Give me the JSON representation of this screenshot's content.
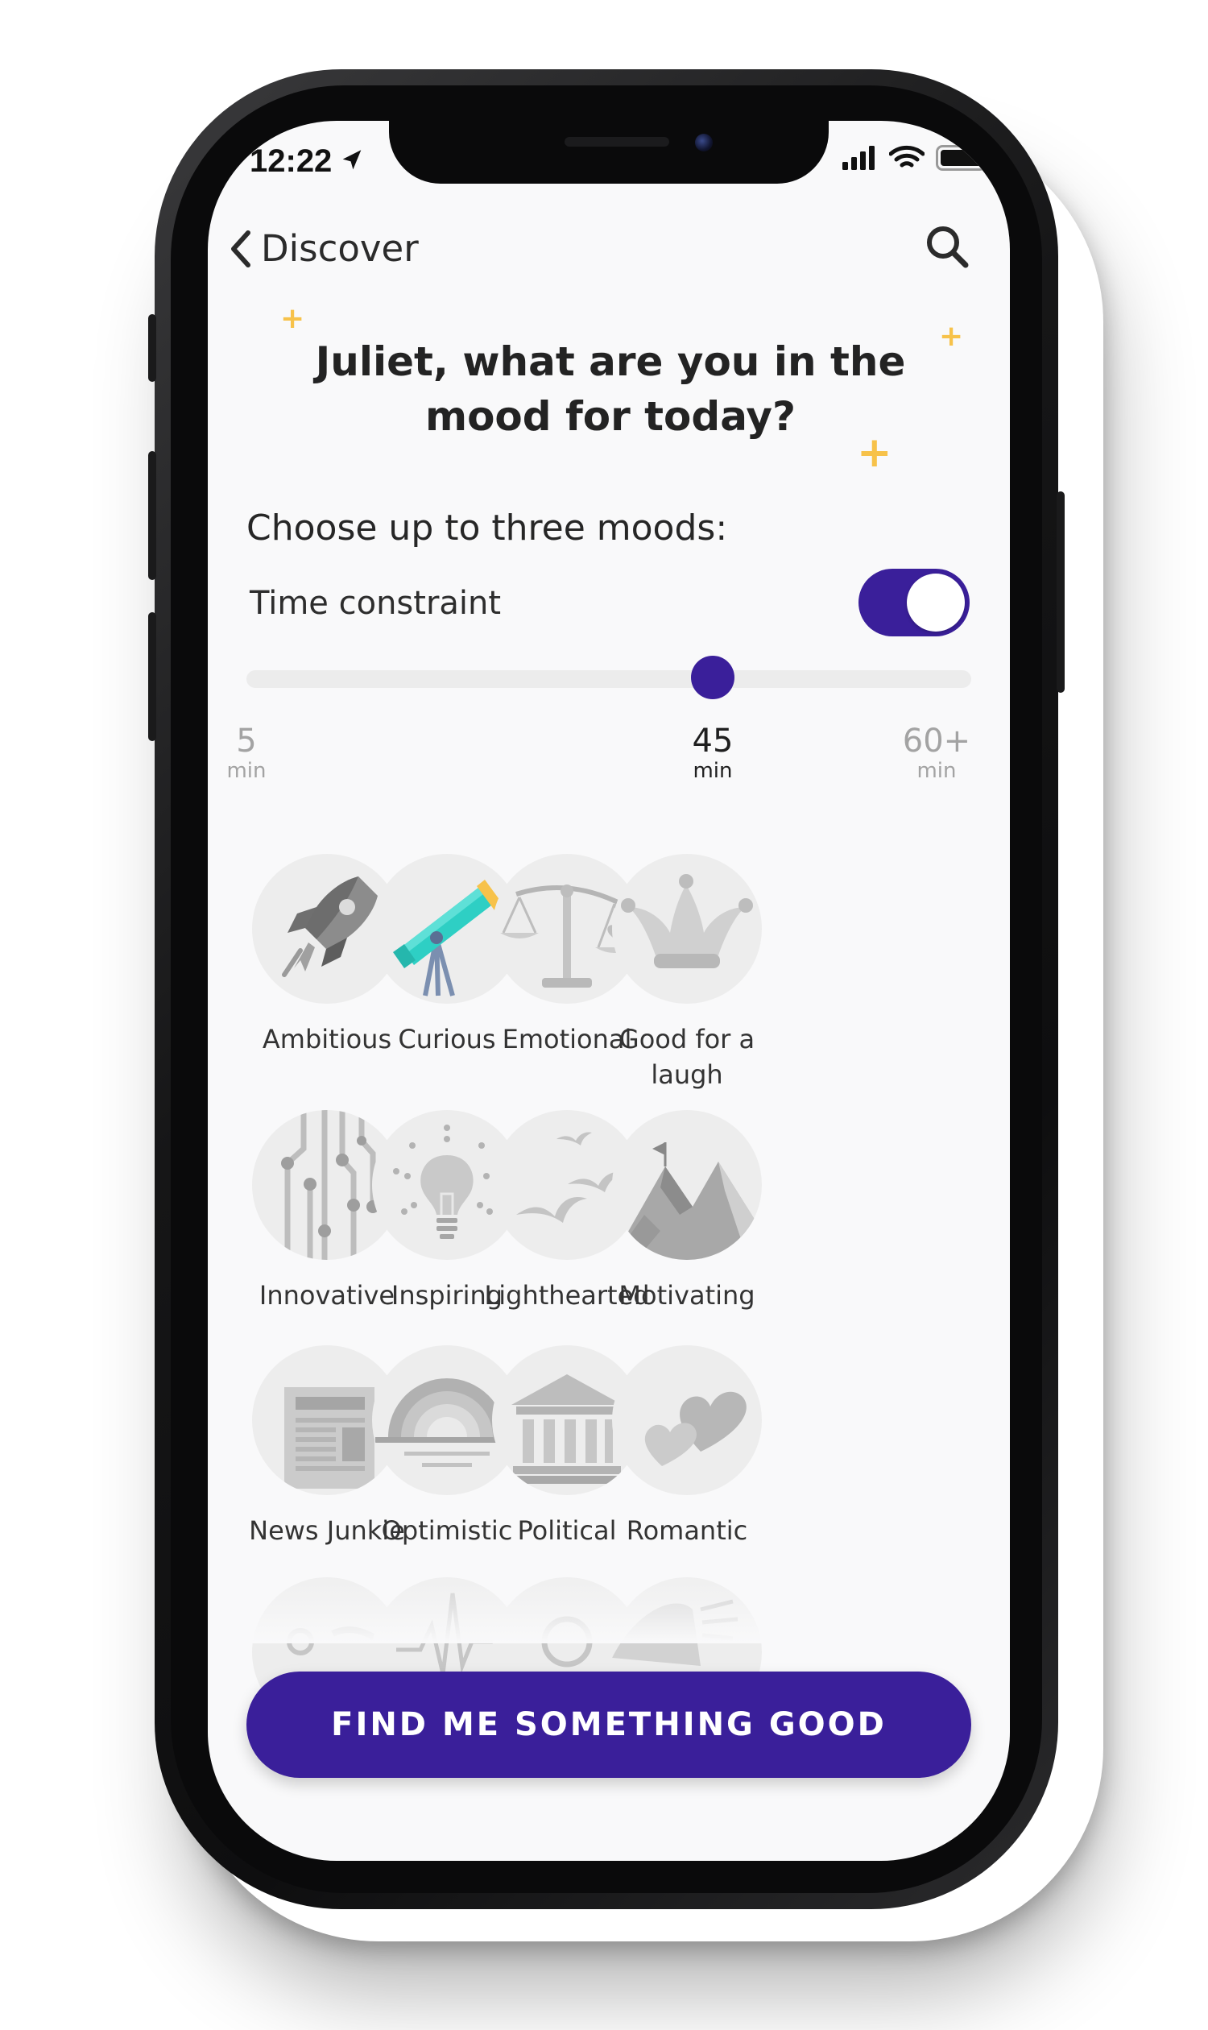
{
  "status": {
    "time": "12:22"
  },
  "nav": {
    "back_label": "Discover"
  },
  "headline": "Juliet, what are you in the mood for today?",
  "subhead": "Choose up to three moods:",
  "time_constraint": {
    "label": "Time constraint",
    "enabled": true,
    "slider": {
      "min_label": "5",
      "selected_label": "45",
      "max_label": "60+",
      "unit": "min",
      "value": 45
    }
  },
  "moods": [
    {
      "label": "Ambitious",
      "icon": "rocket-icon"
    },
    {
      "label": "Curious",
      "icon": "telescope-icon"
    },
    {
      "label": "Emotional",
      "icon": "scales-icon"
    },
    {
      "label": "Good for a laugh",
      "icon": "jester-hat-icon"
    },
    {
      "label": "Innovative",
      "icon": "circuit-icon"
    },
    {
      "label": "Inspiring",
      "icon": "lightbulb-icon"
    },
    {
      "label": "Lighthearted",
      "icon": "birds-icon"
    },
    {
      "label": "Motivating",
      "icon": "mountain-flag-icon"
    },
    {
      "label": "News Junkie",
      "icon": "newspaper-icon"
    },
    {
      "label": "Optimistic",
      "icon": "sunrise-icon"
    },
    {
      "label": "Political",
      "icon": "government-building-icon"
    },
    {
      "label": "Romantic",
      "icon": "hearts-icon"
    }
  ],
  "cta_label": "FIND ME SOMETHING GOOD",
  "colors": {
    "accent": "#3A1F9A",
    "sparkle": "#F7C24A",
    "telescope": "#2ECFC4"
  }
}
